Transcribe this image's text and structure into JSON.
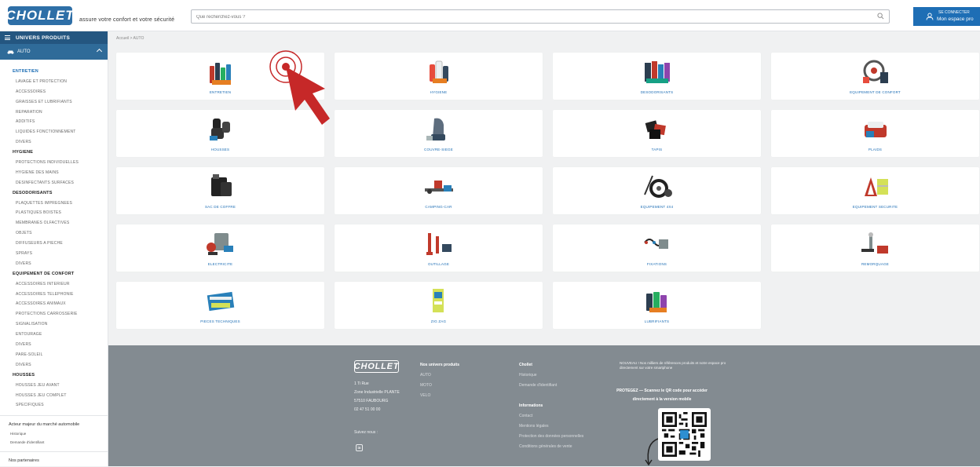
{
  "header": {
    "logo": "CHOLLET",
    "tagline": "assure votre confort et votre sécurité",
    "search_placeholder": "Que recherchez-vous ?",
    "account_line1": "SE CONNECTER",
    "account_line2": "Mon espace pro",
    "accent": "#1e6eb5"
  },
  "sidebar": {
    "title": "UNIVERS PRODUITS",
    "auto_label": "AUTO",
    "groups": [
      {
        "label": "ENTRETIEN",
        "items": [
          "LAVAGE ET PROTECTION",
          "ACCESSOIRES",
          "GRAISSES ET LUBRIFIANTS",
          "REPARATION",
          "ADDITIFS",
          "LIQUIDES FONCTIONNEMENT",
          "DIVERS"
        ]
      },
      {
        "label": "HYGIENE",
        "items": [
          "PROTECTIONS INDIVIDUELLES",
          "HYGIENE DES MAINS",
          "DESINFECTANTS SURFACES"
        ]
      },
      {
        "label": "DESODORISANTS",
        "items": [
          "PLAQUETTES IMPREGNEES",
          "PLASTIQUES BOISTES",
          "MEMBRANES OLFACTIVES",
          "OBJETS",
          "DIFFUSEURS A PIECHE",
          "SPRAYS",
          "DIVERS"
        ]
      },
      {
        "label": "EQUIPEMENT DE CONFORT",
        "items": [
          "ACCESSOIRES INTERIEUR",
          "ACCESSOIRES TELEPHONIE",
          "ACCESSOIRES ANIMAUX",
          "PROTECTIONS CARROSSERIE",
          "SIGNALISATION",
          "ENTOURAGE",
          "DIVERS",
          "PARE-SOLEIL",
          "DIVERS"
        ]
      },
      {
        "label": "HOUSSES",
        "items": [
          "HOUSSES JEU AVANT",
          "HOUSSES JEU COMPLET",
          "SPECIFIQUES"
        ]
      }
    ],
    "footer_title": "Acteur majeur du marché automobile",
    "footer_links": [
      "Historique",
      "Demande d'identifiant"
    ],
    "partners_label": "Nos partenaires"
  },
  "breadcrumb": "Accueil > AUTO",
  "categories": [
    {
      "label": "ENTRETIEN"
    },
    {
      "label": "HYGIENE"
    },
    {
      "label": "DESODORISANTS"
    },
    {
      "label": "EQUIPEMENT DE CONFORT"
    },
    {
      "label": "HOUSSES"
    },
    {
      "label": "COUVRE-SIEGE"
    },
    {
      "label": "TAPIS"
    },
    {
      "label": "PLAIDS"
    },
    {
      "label": "SAC DE COFFRE"
    },
    {
      "label": "CAMPING-CAR"
    },
    {
      "label": "EQUIPEMENT 4X4"
    },
    {
      "label": "EQUIPEMENT SECURITE"
    },
    {
      "label": "ELECTRICITE"
    },
    {
      "label": "OUTILLAGE"
    },
    {
      "label": "FIXATIONS"
    },
    {
      "label": "REMORQUAGE"
    },
    {
      "label": "PIECES TECHNIQUES"
    },
    {
      "label": "ZIG ZAG"
    },
    {
      "label": "LUBRIFIANTS"
    }
  ],
  "footer": {
    "logo": "CHOLLET",
    "address_lines": [
      "1 Ti Rue",
      "Zone Industrielle PLANTE",
      "57510 FAUBOURG",
      "02 47 51 00 00"
    ],
    "follow": "Suivez nous :",
    "linkedin": "in",
    "col1_title": "Nos univers produits",
    "col1_links": [
      "AUTO",
      "MOTO",
      "VELO"
    ],
    "col2_title": "Chollet",
    "col2_links": [
      "Historique",
      "Demande d'identifiant"
    ],
    "col3_title": "Informations",
    "col3_links": [
      "Contact",
      "Mentions légales",
      "Protection des données personnelles",
      "Conditions générales de vente"
    ],
    "news": "NOUVEAU ! Nos milliers de références produits et notre espace pro directement sur votre smartphone",
    "pro_text_1": "PROTEGEZ — Scannez le QR code pour accéder",
    "pro_text_2": "directement à la version mobile"
  }
}
